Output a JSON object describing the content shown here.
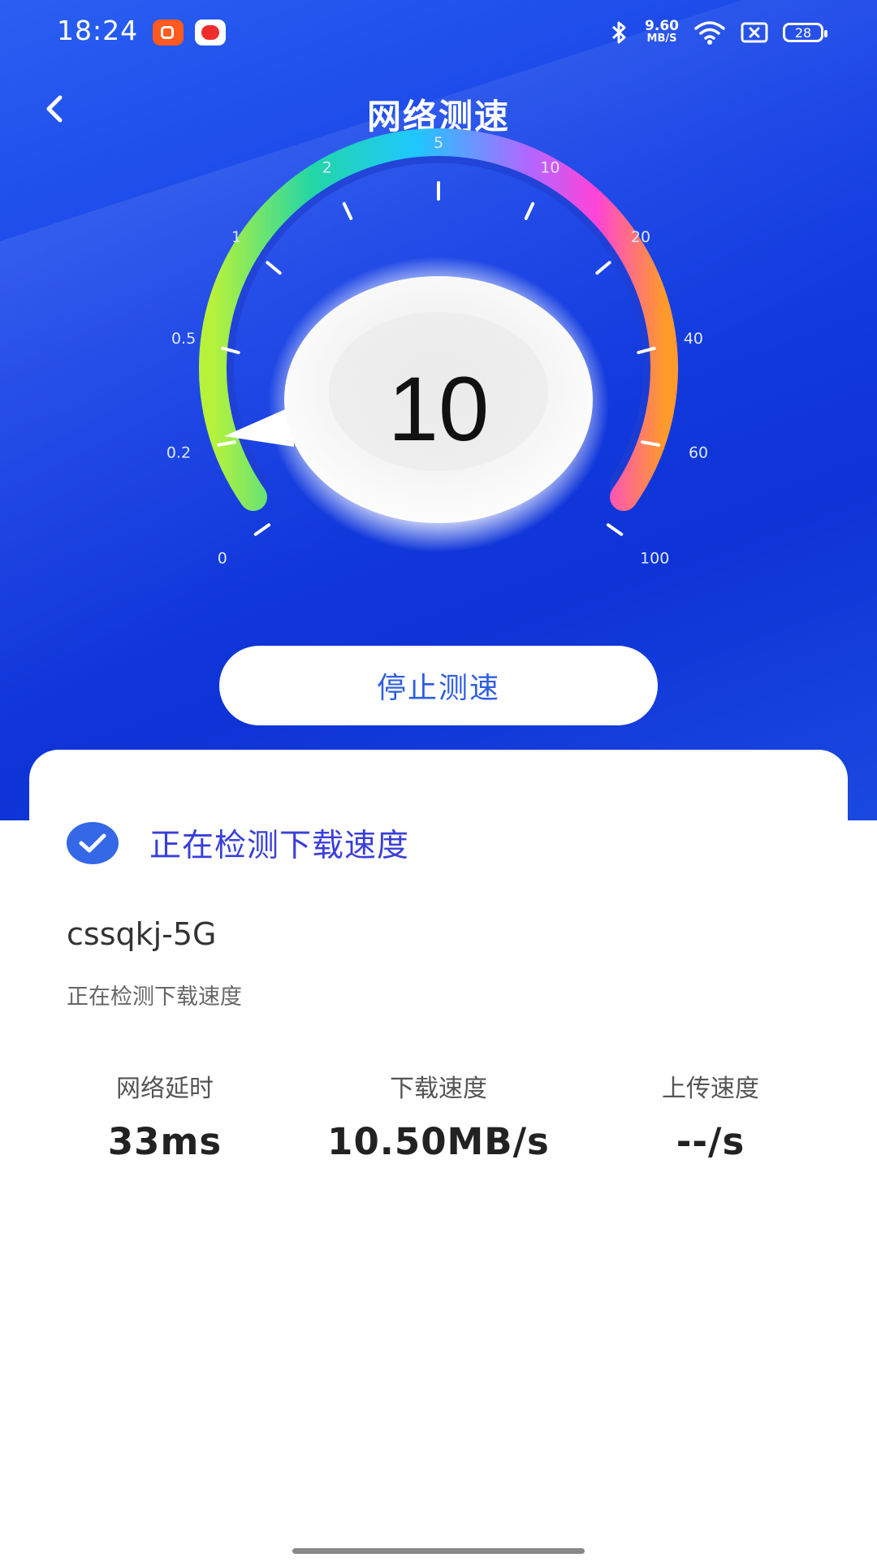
{
  "status_bar": {
    "time": "18:24",
    "net_speed_value": "9.60",
    "net_speed_unit": "MB/S",
    "battery": "28",
    "icons": [
      "bluetooth-icon",
      "wifi-icon",
      "sim-off-icon"
    ]
  },
  "header": {
    "title": "网络测速",
    "back_icon": "back-arrow-icon"
  },
  "gauge": {
    "current_value": "10",
    "scale_labels": [
      "0",
      "0.2",
      "0.5",
      "1",
      "2",
      "5",
      "10",
      "20",
      "40",
      "60",
      "100"
    ],
    "colors": {
      "arc_start": "#b7f23a",
      "arc_green": "#22d6a6",
      "arc_cyan": "#1fc7ff",
      "arc_purple": "#b266ff",
      "arc_pink": "#ff44d8",
      "arc_orange": "#ff9a2b"
    }
  },
  "stop_button": {
    "label": "停止测速"
  },
  "result_card": {
    "status": "正在检测下载速度",
    "ssid": "cssqkj-5G",
    "subtext": "正在检测下载速度",
    "metrics": [
      {
        "label": "网络延时",
        "value": "33ms"
      },
      {
        "label": "下载速度",
        "value": "10.50MB/s"
      },
      {
        "label": "上传速度",
        "value": "--/s"
      }
    ]
  }
}
